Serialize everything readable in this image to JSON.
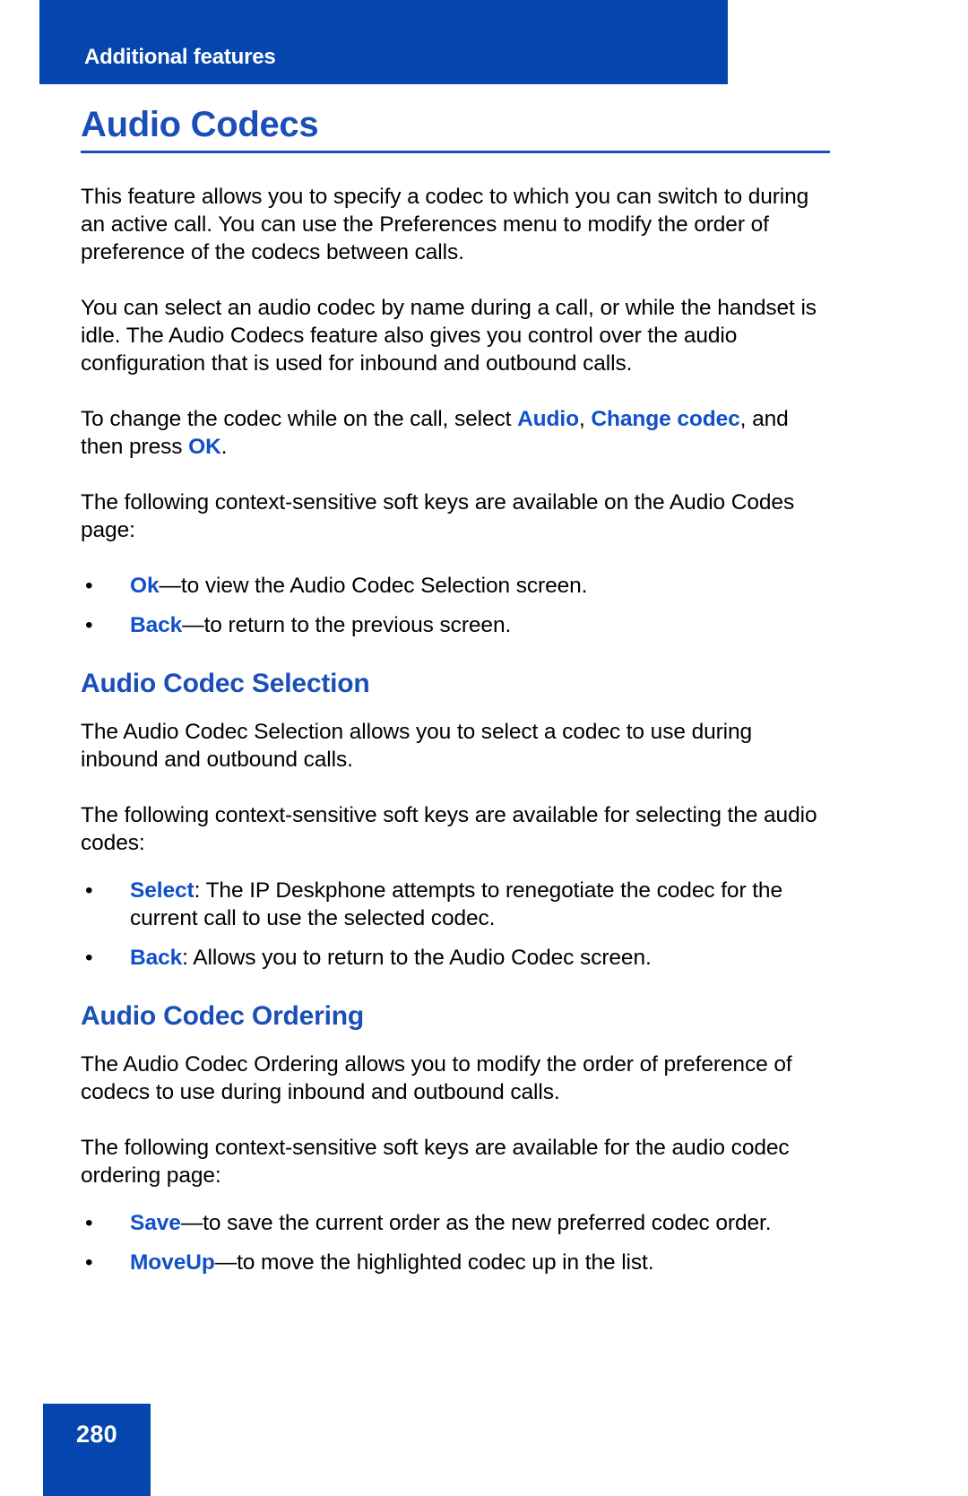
{
  "header": {
    "section_label": "Additional features"
  },
  "title": "Audio Codecs",
  "paragraphs": {
    "intro": "This feature allows you to specify a codec to which you can switch to during an active call. You can use the Preferences menu to modify the order of preference of the codecs between calls.",
    "select_by_name": "You can select an audio codec by name during a call, or while the handset is idle. The Audio Codecs feature also gives you control over the audio configuration that is used for inbound and outbound calls.",
    "change_codec_prefix": "To change the codec while on the call, select ",
    "change_codec_kw1": "Audio",
    "change_codec_sep": ", ",
    "change_codec_kw2": "Change codec",
    "change_codec_mid": ", and then press ",
    "change_codec_kw3": "OK",
    "change_codec_suffix": ".",
    "softkeys_intro": "The following context-sensitive soft keys are available on the Audio Codes page:"
  },
  "audio_codecs_bullets": [
    {
      "bullet": "•",
      "keyword": "Ok",
      "rest": "—to view the Audio Codec Selection screen."
    },
    {
      "bullet": "•",
      "keyword": "Back",
      "rest": "—to return to the previous screen."
    }
  ],
  "selection_section": {
    "heading": "Audio Codec Selection",
    "description": "The Audio Codec Selection allows you to select a codec to use during inbound and outbound calls.",
    "softkeys_intro": "The following context-sensitive soft keys are available for selecting the audio codes:",
    "bullets": [
      {
        "bullet": "•",
        "keyword": "Select",
        "rest": ": The IP Deskphone attempts to renegotiate the codec for the current call to use the selected codec."
      },
      {
        "bullet": "•",
        "keyword": "Back",
        "rest": ": Allows you to return to the Audio Codec screen."
      }
    ]
  },
  "ordering_section": {
    "heading": "Audio Codec Ordering",
    "description": "The Audio Codec Ordering allows you to modify the order of preference of codecs to use during inbound and outbound calls.",
    "softkeys_intro": "The following context-sensitive soft keys are available for the audio codec ordering page:",
    "bullets": [
      {
        "bullet": "•",
        "keyword": "Save",
        "rest": "—to save the current order as the new preferred codec order."
      },
      {
        "bullet": "•",
        "keyword": "MoveUp",
        "rest": "—to move the highlighted codec up in the list."
      }
    ]
  },
  "footer": {
    "page_number": "280"
  },
  "colors": {
    "banner_blue": "#0546ae",
    "heading_blue": "#1a4fb8",
    "keyword_blue": "#1050c8",
    "body_black": "#000000",
    "page_white": "#ffffff"
  }
}
